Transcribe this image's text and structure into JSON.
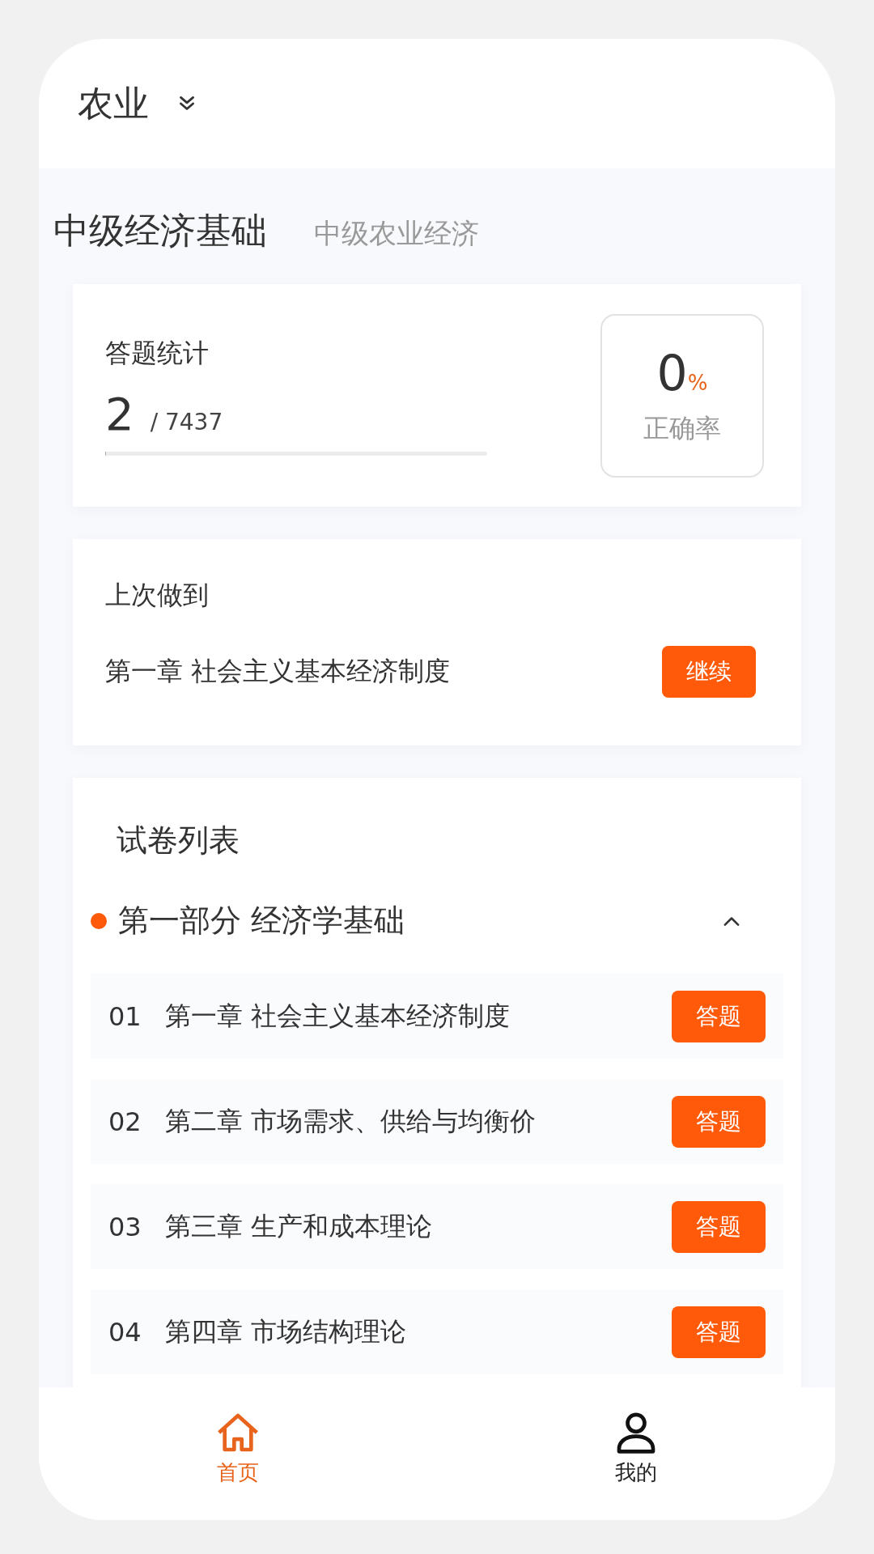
{
  "header": {
    "category": "农业"
  },
  "subjects": [
    {
      "label": "中级经济基础",
      "selected": true
    },
    {
      "label": "中级农业经济",
      "selected": false
    }
  ],
  "stats": {
    "title": "答题统计",
    "done": "2",
    "total": "/ 7437",
    "level": 0.003,
    "rate": "0",
    "rate_unit": "%",
    "rate_label": "正确率"
  },
  "last": {
    "title": "上次做到",
    "chapter": "第一章 社会主义基本经济制度",
    "button": "继续"
  },
  "papers": {
    "title": "试卷列表",
    "section": {
      "title": "第一部分 经济学基础",
      "expanded": true,
      "items": [
        {
          "number": "01",
          "title": "第一章 社会主义基本经济制度",
          "button": "答题"
        },
        {
          "number": "02",
          "title": "第二章 市场需求、供给与均衡价",
          "button": "答题"
        },
        {
          "number": "03",
          "title": "第三章 生产和成本理论",
          "button": "答题"
        },
        {
          "number": "04",
          "title": "第四章 市场结构理论",
          "button": "答题"
        }
      ]
    }
  },
  "nav": [
    {
      "label": "首页",
      "kind": "home",
      "selected": true
    },
    {
      "label": "我的",
      "kind": "profile",
      "selected": false
    }
  ]
}
